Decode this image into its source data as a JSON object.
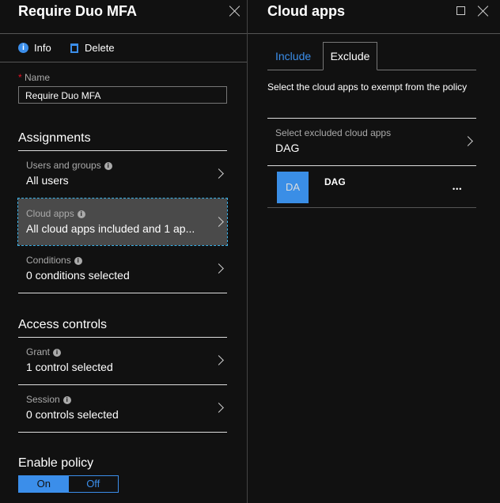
{
  "left": {
    "title": "Require Duo MFA",
    "toolbar": {
      "info": "Info",
      "delete": "Delete"
    },
    "name_label": "Name",
    "name_required": "*",
    "name_value": "Require Duo MFA",
    "assignments": "Assignments",
    "rows": [
      {
        "label": "Users and groups",
        "value": "All users"
      },
      {
        "label": "Cloud apps",
        "value": "All cloud apps included and 1 ap..."
      },
      {
        "label": "Conditions",
        "value": "0 conditions selected"
      }
    ],
    "access_controls": "Access controls",
    "access_rows": [
      {
        "label": "Grant",
        "value": "1 control selected"
      },
      {
        "label": "Session",
        "value": "0 controls selected"
      }
    ],
    "enable_policy": "Enable policy",
    "toggle": {
      "on": "On",
      "off": "Off",
      "selected": "On"
    }
  },
  "right": {
    "title": "Cloud apps",
    "tabs": [
      "Include",
      "Exclude"
    ],
    "active_tab": "Exclude",
    "description": "Select the cloud apps to exempt from the policy",
    "select_label": "Select excluded cloud apps",
    "select_value": "DAG",
    "apps": [
      {
        "initials": "DA",
        "name": "DAG",
        "more": "•••"
      }
    ]
  },
  "colors": {
    "accent": "#3b8eea",
    "app_tile": "#3a8ee6",
    "background": "#111111"
  }
}
